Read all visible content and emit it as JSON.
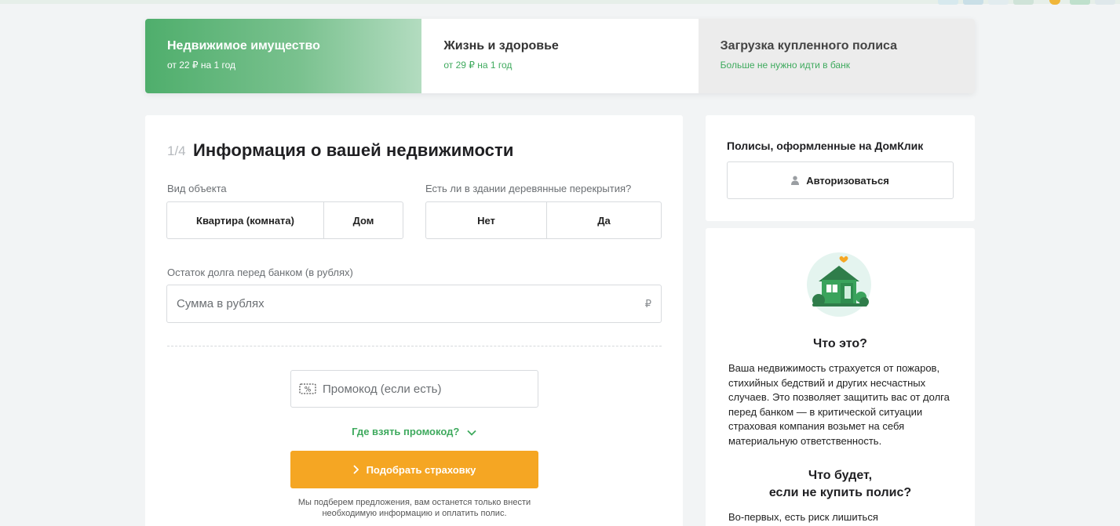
{
  "tabs": [
    {
      "title": "Недвижимое имущество",
      "subtitle": "от 22 ₽ на 1 год"
    },
    {
      "title": "Жизнь и здоровье",
      "subtitle": "от 29 ₽ на 1 год"
    },
    {
      "title": "Загрузка купленного полиса",
      "subtitle": "Больше не нужно идти в банк"
    }
  ],
  "form": {
    "step": "1/4",
    "title": "Информация о вашей недвижимости",
    "object_type_label": "Вид объекта",
    "object_type_options": [
      "Квартира (комната)",
      "Дом"
    ],
    "wooden_label": "Есть ли в здании деревянные перекрытия?",
    "wooden_options": [
      "Нет",
      "Да"
    ],
    "debt_label": "Остаток долга перед банком (в рублях)",
    "debt_placeholder": "Сумма в рублях",
    "currency": "₽",
    "promo_placeholder": "Промокод (если есть)",
    "promo_link": "Где взять промокод?",
    "submit": "Подобрать страховку",
    "note": "Мы подберем предложения, вам останется только внести необходимую информацию и оплатить полис."
  },
  "sidebar": {
    "policies_title": "Полисы, оформленные на ДомКлик",
    "auth_button": "Авторизоваться",
    "what_title": "Что это?",
    "what_text": "Ваша недвижимость страхуется от пожаров, стихийных бедствий и других несчастных случаев. Это позволяет защитить вас от долга перед банком — в критической ситуации страховая компания возьмет на себя материальную ответственность.",
    "what_if_title_1": "Что будет,",
    "what_if_title_2": "если не купить полис?",
    "what_if_text": "Во-первых, есть риск лишиться"
  },
  "colors": {
    "accent": "#3faa5e",
    "button": "#f5a623"
  }
}
